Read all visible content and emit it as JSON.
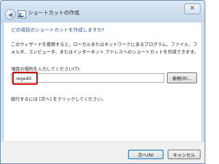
{
  "window": {
    "title": "ショートカットの作成",
    "close_symbol": "✕",
    "back_symbol": "◀"
  },
  "content": {
    "heading": "どの項目のショートカットを作成しますか?",
    "description": "このウィザードを使用すると、ローカルまたはネットワークにあるプログラム、ファイル、フォルダ、コンピュータ、またはインターネット アドレスへのショートカットを作成できます。",
    "field_label": "項目の場所を入力してください(T):",
    "location_value": "regedit",
    "browse_label": "参照(R)...",
    "continue_text": "続行するには [次へ] をクリックしてください。"
  },
  "footer": {
    "next_label": "次へ(N)",
    "cancel_label": "キャンセル"
  },
  "colors": {
    "heading_text": "#2c4e97",
    "highlight_box": "#d10000",
    "frame_blue": "#cfe0f1",
    "footer_bg": "#f0f0f0"
  },
  "icons": {
    "close": "close-icon",
    "back": "back-arrow-icon",
    "shortcut": "shortcut-icon"
  }
}
